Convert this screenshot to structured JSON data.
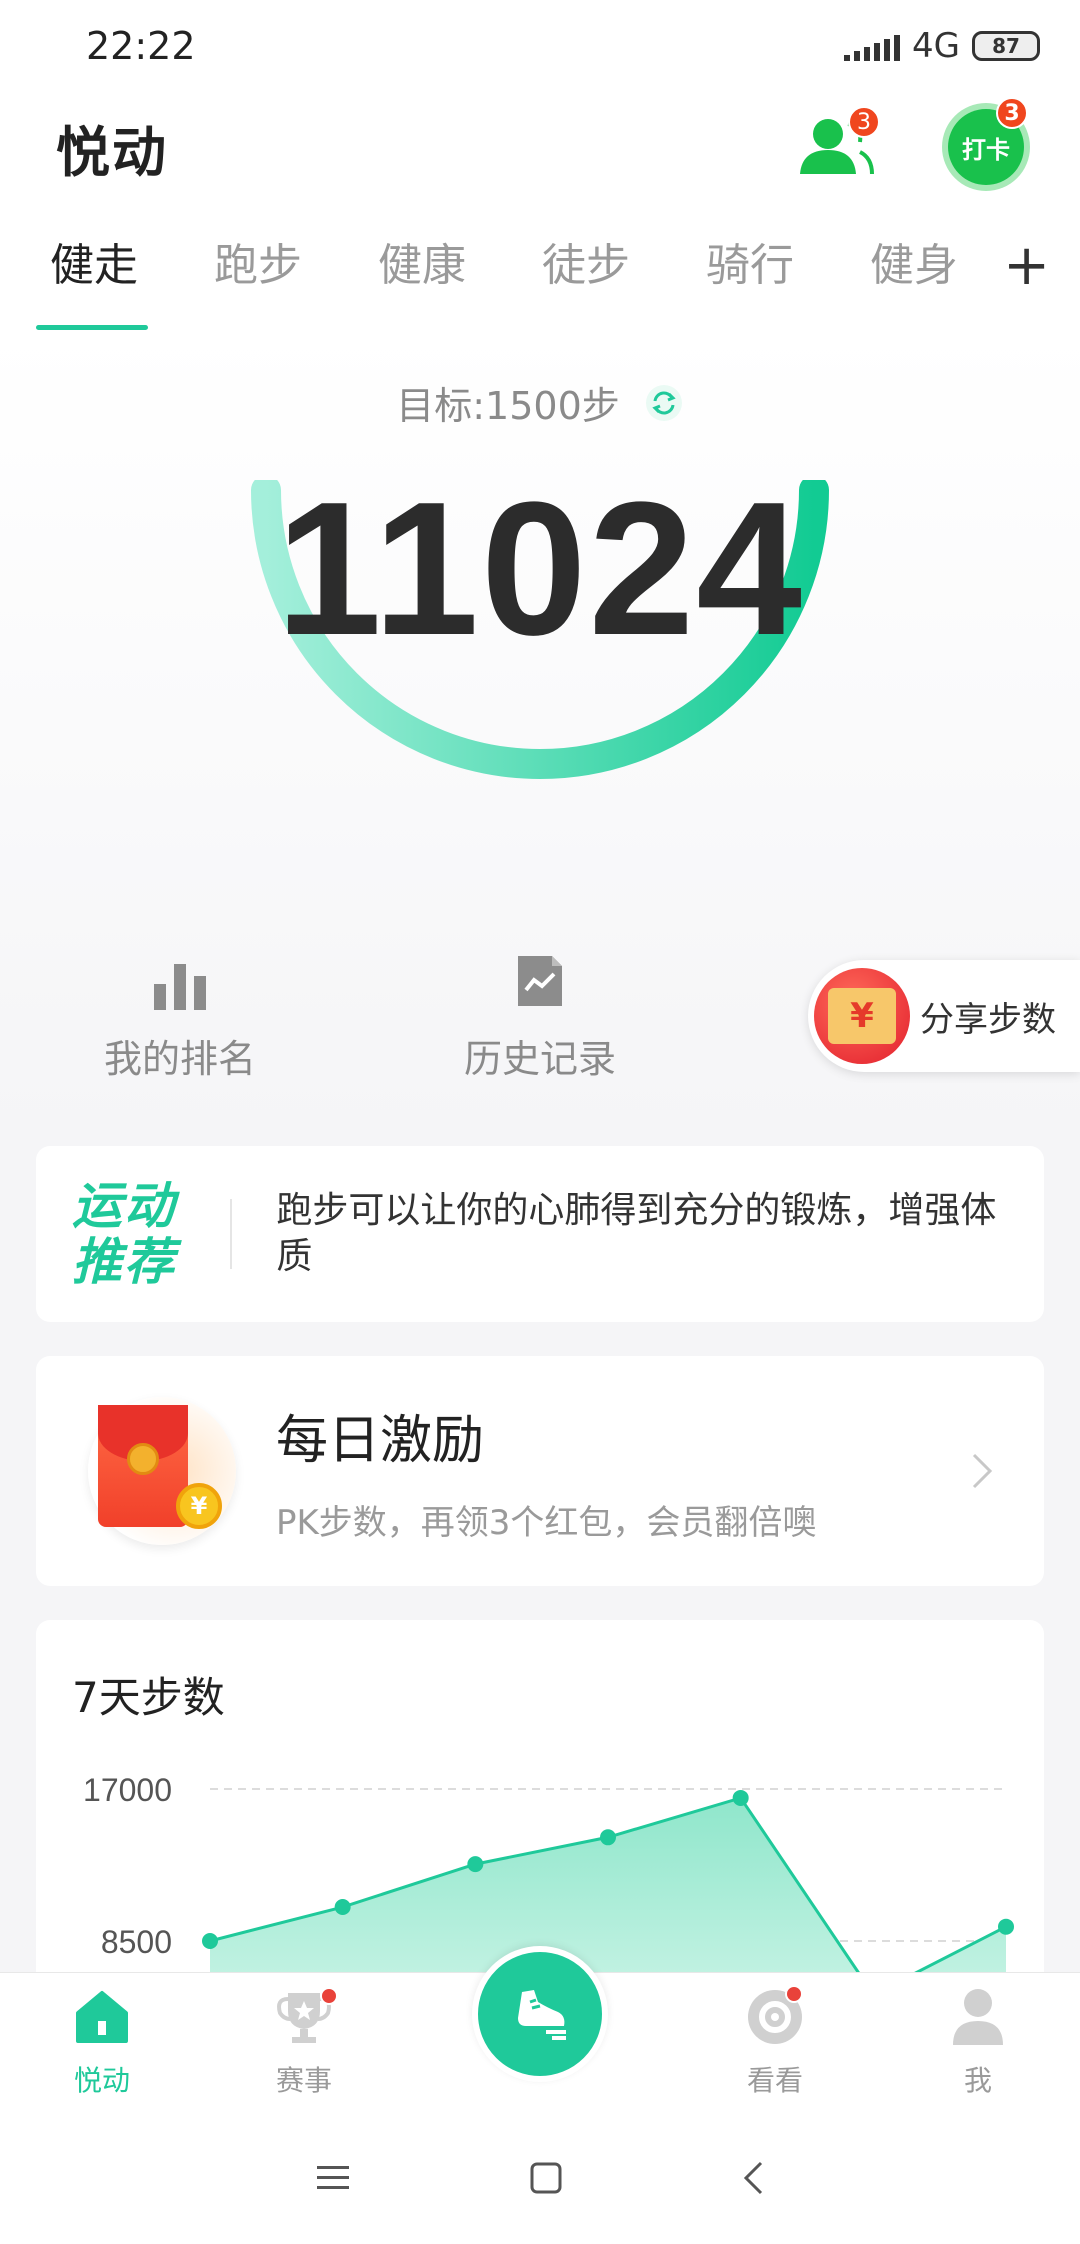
{
  "status_bar": {
    "time": "22:22",
    "network": "4G",
    "battery": "87"
  },
  "header": {
    "title": "悦动",
    "friends_badge": "3",
    "checkin_label": "打卡",
    "checkin_badge": "3"
  },
  "tabs": [
    {
      "label": "健走",
      "active": true
    },
    {
      "label": "跑步",
      "active": false
    },
    {
      "label": "健康",
      "active": false
    },
    {
      "label": "徒步",
      "active": false
    },
    {
      "label": "骑行",
      "active": false
    },
    {
      "label": "健身",
      "active": false
    }
  ],
  "tab_add": "+",
  "hero": {
    "goal": "目标:1500步",
    "steps": "11024",
    "accent": "#1fc99a"
  },
  "quick_actions": {
    "ranking": "我的排名",
    "history": "历史记录",
    "share": "分享步数"
  },
  "recommend": {
    "tag_line1": "运动",
    "tag_line2": "推荐",
    "text": "跑步可以让你的心肺得到充分的锻炼，增强体质"
  },
  "daily_reward": {
    "title": "每日激励",
    "subtitle": "PK步数，再领3个红包，会员翻倍噢"
  },
  "chart_data": {
    "type": "area",
    "title": "7天步数",
    "ytick_labels": [
      "17000",
      "8500"
    ],
    "ylim": [
      0,
      17000
    ],
    "grid": true,
    "x": [
      1,
      2,
      3,
      4,
      5,
      6,
      7
    ],
    "values": [
      8500,
      10400,
      12800,
      14300,
      16500,
      5500,
      9300
    ]
  },
  "bottom_nav": [
    {
      "label": "悦动",
      "icon": "home-icon",
      "active": true
    },
    {
      "label": "赛事",
      "icon": "trophy-icon",
      "active": false
    },
    {
      "label": "看看",
      "icon": "discover-icon",
      "active": false
    },
    {
      "label": "我",
      "icon": "profile-icon",
      "active": false
    }
  ]
}
